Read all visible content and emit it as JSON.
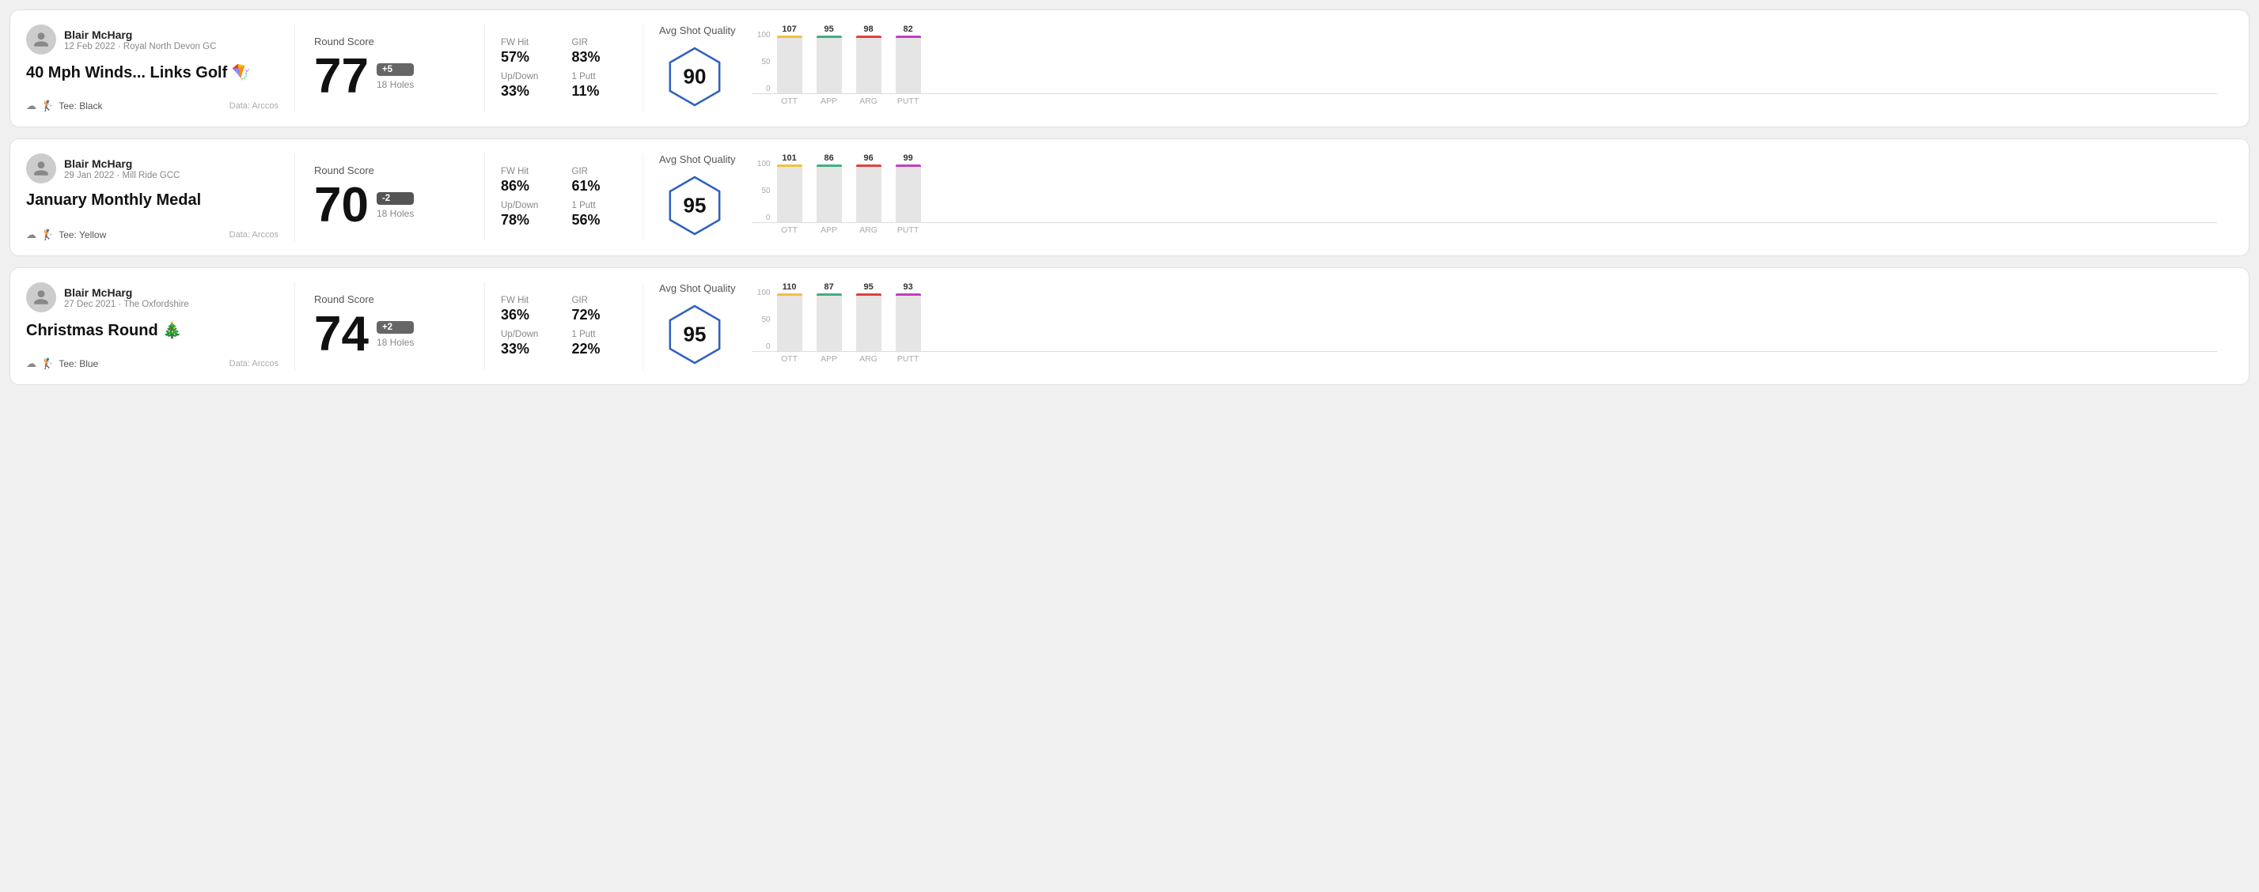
{
  "rounds": [
    {
      "id": "round-1",
      "user": {
        "name": "Blair McHarg",
        "date": "12 Feb 2022 · Royal North Devon GC"
      },
      "title": "40 Mph Winds... Links Golf 🪁",
      "tee": "Black",
      "data_source": "Data: Arccos",
      "score": {
        "label": "Round Score",
        "number": "77",
        "badge": "+5",
        "badge_type": "over",
        "holes": "18 Holes"
      },
      "stats": {
        "fw_hit_label": "FW Hit",
        "fw_hit_value": "57%",
        "gir_label": "GIR",
        "gir_value": "83%",
        "updown_label": "Up/Down",
        "updown_value": "33%",
        "one_putt_label": "1 Putt",
        "one_putt_value": "11%"
      },
      "quality": {
        "label": "Avg Shot Quality",
        "score": "90",
        "bars": [
          {
            "label": "OTT",
            "value": 107,
            "color": "#f0c040"
          },
          {
            "label": "APP",
            "value": 95,
            "color": "#40b080"
          },
          {
            "label": "ARG",
            "value": 98,
            "color": "#e04040"
          },
          {
            "label": "PUTT",
            "value": 82,
            "color": "#c040c0"
          }
        ],
        "y_max": 100,
        "y_labels": [
          "100",
          "50",
          "0"
        ]
      }
    },
    {
      "id": "round-2",
      "user": {
        "name": "Blair McHarg",
        "date": "29 Jan 2022 · Mill Ride GCC"
      },
      "title": "January Monthly Medal",
      "tee": "Yellow",
      "data_source": "Data: Arccos",
      "score": {
        "label": "Round Score",
        "number": "70",
        "badge": "-2",
        "badge_type": "under",
        "holes": "18 Holes"
      },
      "stats": {
        "fw_hit_label": "FW Hit",
        "fw_hit_value": "86%",
        "gir_label": "GIR",
        "gir_value": "61%",
        "updown_label": "Up/Down",
        "updown_value": "78%",
        "one_putt_label": "1 Putt",
        "one_putt_value": "56%"
      },
      "quality": {
        "label": "Avg Shot Quality",
        "score": "95",
        "bars": [
          {
            "label": "OTT",
            "value": 101,
            "color": "#f0c040"
          },
          {
            "label": "APP",
            "value": 86,
            "color": "#40b080"
          },
          {
            "label": "ARG",
            "value": 96,
            "color": "#e04040"
          },
          {
            "label": "PUTT",
            "value": 99,
            "color": "#c040c0"
          }
        ],
        "y_max": 100,
        "y_labels": [
          "100",
          "50",
          "0"
        ]
      }
    },
    {
      "id": "round-3",
      "user": {
        "name": "Blair McHarg",
        "date": "27 Dec 2021 · The Oxfordshire"
      },
      "title": "Christmas Round 🎄",
      "tee": "Blue",
      "data_source": "Data: Arccos",
      "score": {
        "label": "Round Score",
        "number": "74",
        "badge": "+2",
        "badge_type": "over",
        "holes": "18 Holes"
      },
      "stats": {
        "fw_hit_label": "FW Hit",
        "fw_hit_value": "36%",
        "gir_label": "GIR",
        "gir_value": "72%",
        "updown_label": "Up/Down",
        "updown_value": "33%",
        "one_putt_label": "1 Putt",
        "one_putt_value": "22%"
      },
      "quality": {
        "label": "Avg Shot Quality",
        "score": "95",
        "bars": [
          {
            "label": "OTT",
            "value": 110,
            "color": "#f0c040"
          },
          {
            "label": "APP",
            "value": 87,
            "color": "#40b080"
          },
          {
            "label": "ARG",
            "value": 95,
            "color": "#e04040"
          },
          {
            "label": "PUTT",
            "value": 93,
            "color": "#c040c0"
          }
        ],
        "y_max": 100,
        "y_labels": [
          "100",
          "50",
          "0"
        ]
      }
    }
  ]
}
